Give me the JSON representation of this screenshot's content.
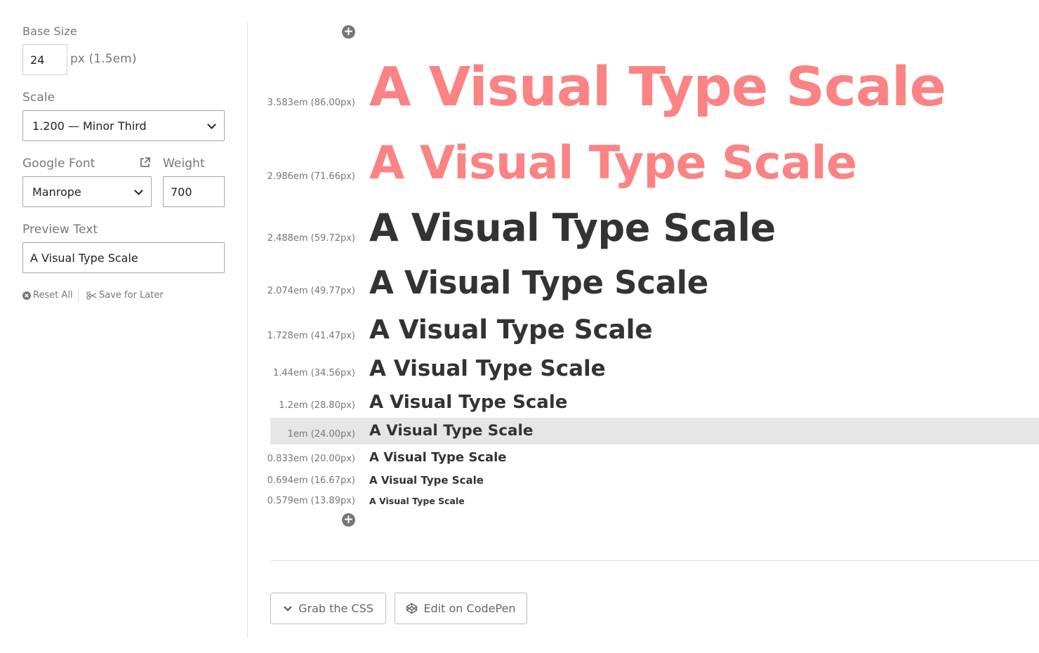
{
  "sidebar": {
    "base_size_label": "Base Size",
    "base_size_value": "24",
    "base_size_unit": "px (1.5em)",
    "scale_label": "Scale",
    "scale_value": "1.200 — Minor Third",
    "font_label": "Google Font",
    "font_value": "Manrope",
    "weight_label": "Weight",
    "weight_value": "700",
    "preview_label": "Preview Text",
    "preview_value": "A Visual Type Scale",
    "reset_label": "Reset All",
    "save_label": "Save for Later"
  },
  "scale_rows": [
    {
      "size": "3.583em (86.00px)",
      "text": "A Visual Type Scale"
    },
    {
      "size": "2.986em (71.66px)",
      "text": "A Visual Type Scale"
    },
    {
      "size": "2.488em (59.72px)",
      "text": "A Visual Type Scale"
    },
    {
      "size": "2.074em (49.77px)",
      "text": "A Visual Type Scale"
    },
    {
      "size": "1.728em (41.47px)",
      "text": "A Visual Type Scale"
    },
    {
      "size": "1.44em (34.56px)",
      "text": "A Visual Type Scale"
    },
    {
      "size": "1.2em (28.80px)",
      "text": "A Visual Type Scale"
    },
    {
      "size": "1em (24.00px)",
      "text": "A Visual Type Scale"
    },
    {
      "size": "0.833em (20.00px)",
      "text": "A Visual Type Scale"
    },
    {
      "size": "0.694em (16.67px)",
      "text": "A Visual Type Scale"
    },
    {
      "size": "0.579em (13.89px)",
      "text": "A Visual Type Scale"
    }
  ],
  "actions": {
    "grab_css": "Grab the CSS",
    "codepen": "Edit on CodePen"
  },
  "colors": {
    "accent": "#fb8383",
    "text": "#333333",
    "muted": "#777777",
    "highlight": "#e6e6e6"
  }
}
